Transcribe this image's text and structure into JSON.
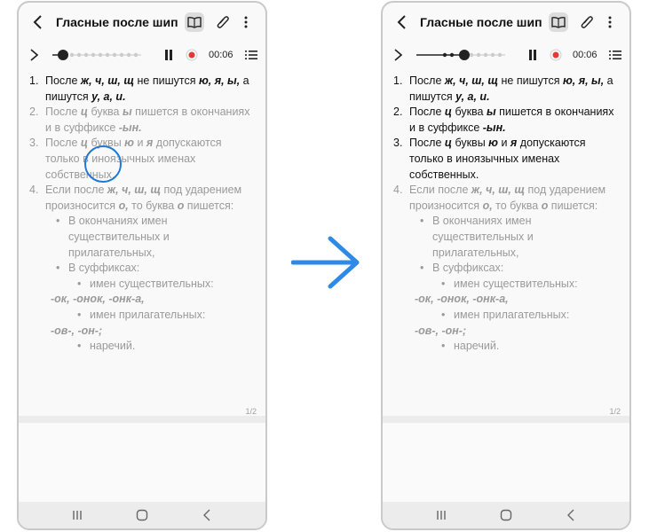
{
  "header": {
    "title": "Гласные после шипящих"
  },
  "player": {
    "time": "00:06"
  },
  "note": {
    "item1": {
      "num": "1.",
      "a": "После ",
      "b": "ж, ч, ш, щ",
      "c": " не пишутся ",
      "d": "ю, я, ы,",
      "e": " а пишутся ",
      "f": "у, а, и."
    },
    "item2": {
      "num": "2.",
      "a": "После ",
      "b": "ц",
      "c": " буква ",
      "d": "ы",
      "e": " пишется в окончаниях и в суффиксе ",
      "f": "-ын."
    },
    "item3": {
      "num": "3.",
      "a": "После ",
      "b": "ц",
      "c": " буквы ",
      "d": "ю",
      "e": " и ",
      "f": "я",
      "g": " допускаются только в иноязычных именах собственных."
    },
    "item4": {
      "num": "4.",
      "a": "Если после ",
      "b": "ж, ч, ш, щ",
      "c": " под ударением произносится ",
      "d": "о,",
      "e": " то буква ",
      "f": "о",
      "g": " пишется:"
    },
    "bullet1": "В окончаниях имен существительных и прилагательных,",
    "bullet2": "В суффиксах:",
    "sub1": "имен существительных:",
    "suffix1": "-ок, -онок, -онк-а,",
    "sub2": "имен прилагательных:",
    "suffix2": "-ов-, -он-;",
    "sub3": "наречий."
  },
  "page_indicator": "1/2",
  "colors": {
    "tap_ring": "#1f78d6",
    "arrow": "#2f8ae6",
    "record": "#e53935"
  },
  "icons": [
    "back-icon",
    "book-icon",
    "paperclip-icon",
    "more-icon",
    "play-icon",
    "pause-icon",
    "record-icon",
    "list-icon",
    "recents-icon",
    "home-icon",
    "nav-back-icon"
  ]
}
